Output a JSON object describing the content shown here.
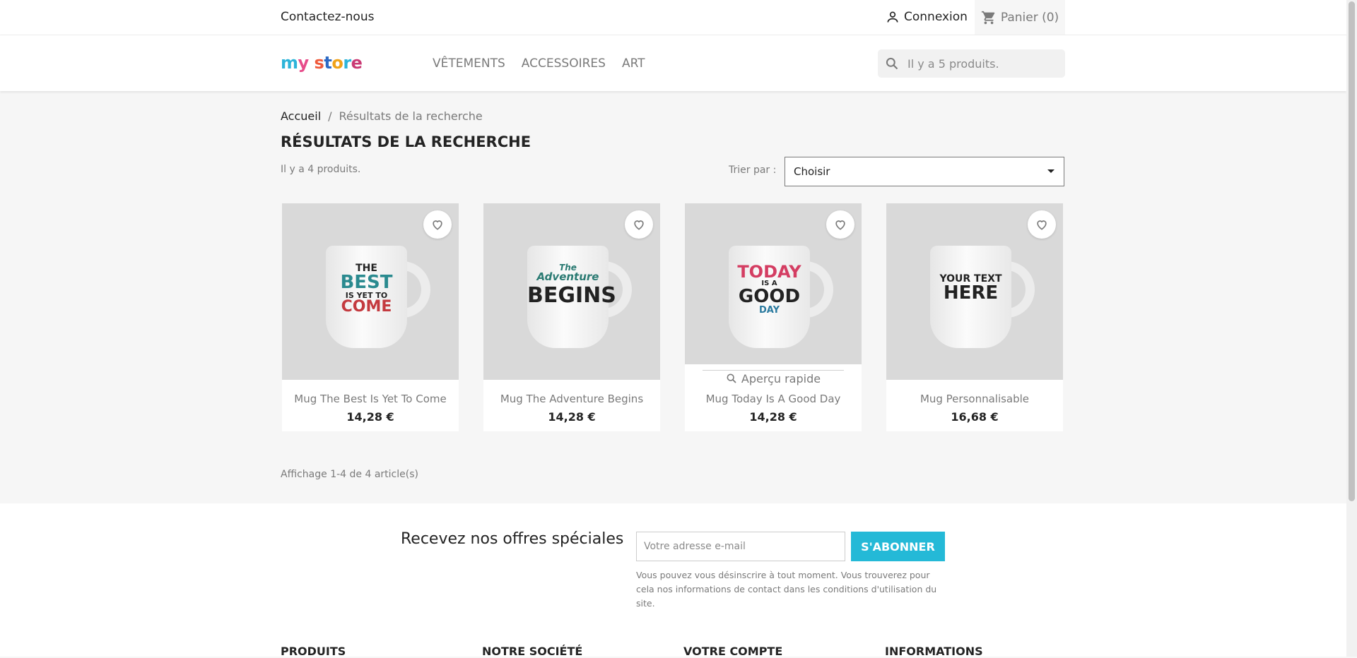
{
  "topbar": {
    "contact": "Contactez-nous",
    "login": "Connexion",
    "cart": "Panier (0)"
  },
  "header": {
    "logo": {
      "my": "my",
      "store": "store"
    },
    "nav": [
      "VÊTEMENTS",
      "ACCESSOIRES",
      "ART"
    ],
    "search_placeholder": "Il y a 5 produits."
  },
  "breadcrumb": {
    "home": "Accueil",
    "separator": "/",
    "current": "Résultats de la recherche"
  },
  "page_title": "RÉSULTATS DE LA RECHERCHE",
  "count": "Il y a 4 produits.",
  "sort": {
    "label": "Trier par :",
    "value": "Choisir"
  },
  "products": [
    {
      "name": "Mug The Best Is Yet To Come",
      "price": "14,28 €",
      "mug_text": [
        "THE",
        "BEST",
        "IS YET TO",
        "COME"
      ]
    },
    {
      "name": "Mug The Adventure Begins",
      "price": "14,28 €",
      "mug_text": [
        "The",
        "Adventure",
        "BEGINS"
      ]
    },
    {
      "name": "Mug Today Is A Good Day",
      "price": "14,28 €",
      "mug_text": [
        "TODAY",
        "IS A",
        "GOOD",
        "DAY"
      ],
      "quick_view": "Aperçu rapide"
    },
    {
      "name": "Mug Personnalisable",
      "price": "16,68 €",
      "mug_text": [
        "YOUR TEXT",
        "HERE"
      ]
    }
  ],
  "pagination": "Affichage 1-4 de 4 article(s)",
  "newsletter": {
    "title": "Recevez nos offres spéciales",
    "placeholder": "Votre adresse e-mail",
    "button": "S'ABONNER",
    "note": "Vous pouvez vous désinscrire à tout moment. Vous trouverez pour cela nos informations de contact dans les conditions d'utilisation du site."
  },
  "footer_columns": [
    "PRODUITS",
    "NOTRE SOCIÉTÉ",
    "VOTRE COMPTE",
    "INFORMATIONS"
  ],
  "colors": {
    "accent": "#24b9d7",
    "text": "#232323",
    "muted": "#7a7a7a",
    "background": "#f6f6f6"
  }
}
